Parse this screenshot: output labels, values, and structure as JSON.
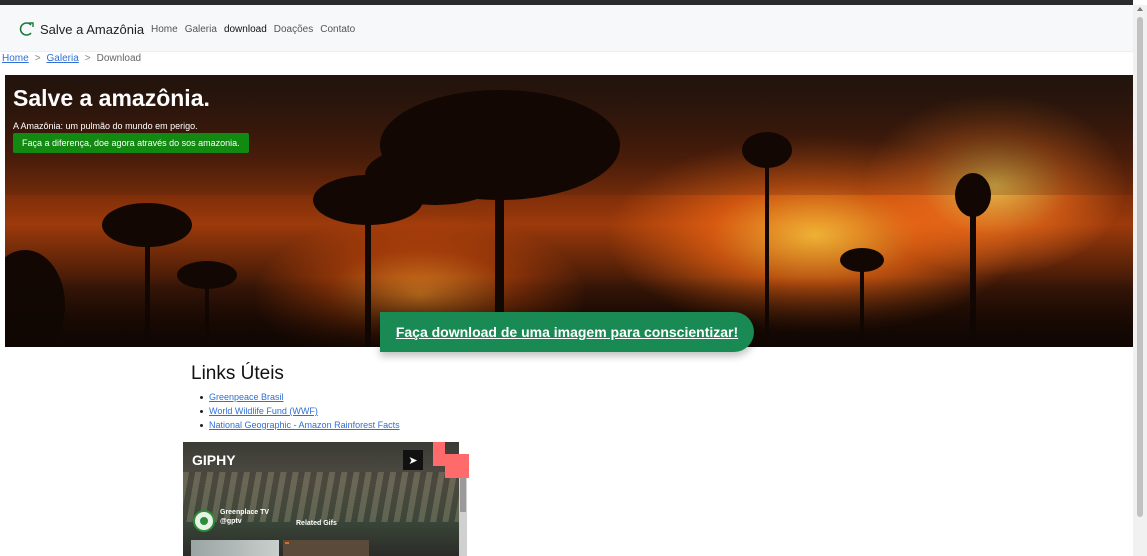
{
  "navbar": {
    "brand_text": "Salve a Amazônia",
    "brand_icon": "leaf-icon",
    "links": [
      "Home",
      "Galeria",
      "download",
      "Doações",
      "Contato"
    ],
    "active_link": "download"
  },
  "breadcrumb": {
    "items": [
      "Home",
      "Galeria",
      "Download"
    ],
    "separator": ">"
  },
  "hero": {
    "title": "Salve a amazônia.",
    "subtitle": "A Amazônia: um pulmão do mundo em perigo.",
    "cta": "Faça a diferença, doe agora através do sos amazonia.",
    "download_button": "Faça download de uma imagem para conscientizar!"
  },
  "links": {
    "title": "Links Úteis",
    "items": [
      "Greenpeace Brasil",
      "World Wildlife Fund (WWF)",
      "National Geographic - Amazon Rainforest Facts"
    ]
  },
  "giphy": {
    "logo": "GIPHY",
    "user_name": "Greenplace TV",
    "user_handle": "@gptv",
    "related": "Related Gifs",
    "send_icon": "send-icon"
  },
  "colors": {
    "accent_green": "#1a8a55",
    "cta_green": "#128a12",
    "link_blue": "#2f6fd6",
    "giphy_corner": "#ff6b6b"
  }
}
